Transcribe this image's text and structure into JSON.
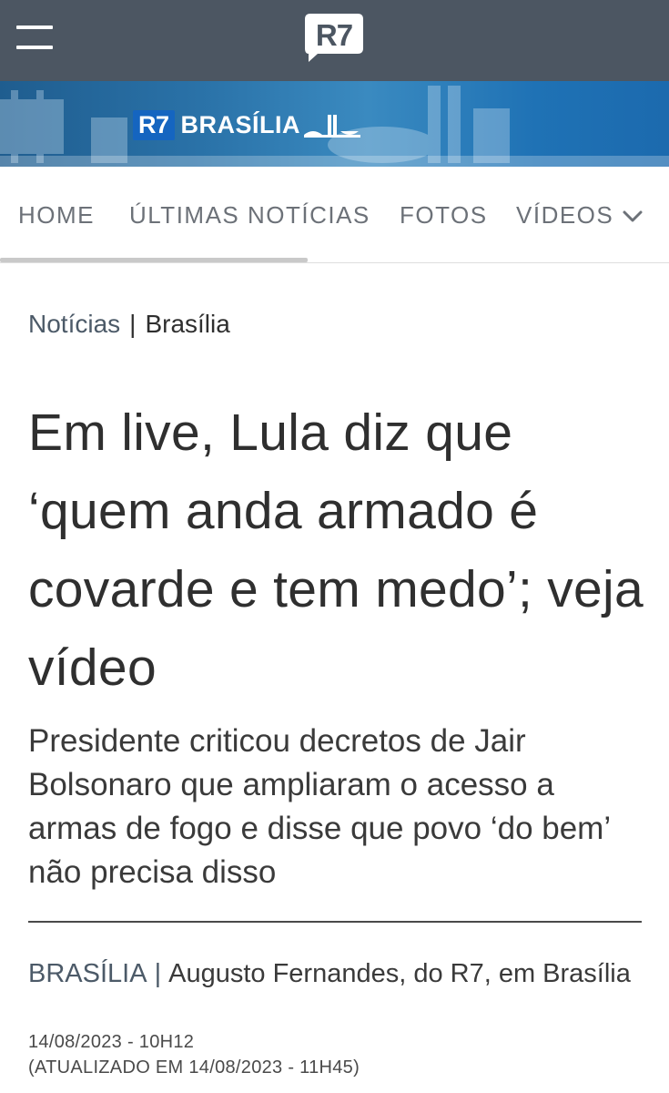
{
  "header": {
    "logo_text": "R7",
    "colors": {
      "topbar": "#4c5662",
      "logo_bg": "#ffffff"
    }
  },
  "banner": {
    "badge": "R7",
    "title": "BRASÍLIA"
  },
  "nav": {
    "items": [
      {
        "label": "HOME"
      },
      {
        "label": "ÚLTIMAS NOTÍCIAS"
      },
      {
        "label": "FOTOS"
      },
      {
        "label": "VÍDEOS"
      }
    ]
  },
  "breadcrumb": {
    "parent": "Notícias",
    "separator": "|",
    "current": "Brasília"
  },
  "article": {
    "headline": "Em live, Lula diz que ‘quem anda armado é covarde e tem medo’; veja vídeo",
    "subtitle": "Presidente criticou decretos de Jair Bolsonaro que ampliaram o acesso a armas de fogo e disse que povo ‘do bem’ não precisa disso",
    "section": "BRASÍLIA",
    "byline_sep": "|",
    "author": "Augusto Fernandes, do R7, em Brasília",
    "date": "14/08/2023 - 10H12",
    "updated": "(ATUALIZADO EM 14/08/2023 - 11H45)"
  }
}
